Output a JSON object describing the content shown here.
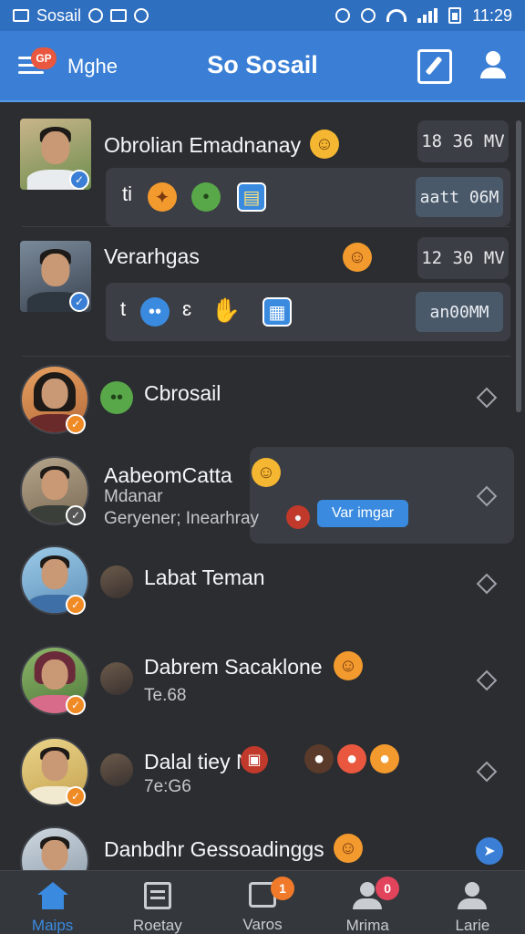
{
  "status_bar": {
    "carrier": "Sosail",
    "time": "11:29"
  },
  "app_bar": {
    "menu_badge": "GP",
    "back_label": "Mghe",
    "title": "So Sosail"
  },
  "cards": [
    {
      "name": "Obrolian Emadnanay",
      "time": "18 36 MV",
      "action": "aatt 06M",
      "lead_glyph": "ti"
    },
    {
      "name": "Verarhgas",
      "time": "12 30 MV",
      "action": "an00MM",
      "lead_glyph": "t",
      "second_glyph": "ɛ"
    }
  ],
  "rows": [
    {
      "name": "Cbrosail"
    },
    {
      "name": "AabeomCatta",
      "line2": "Mdanar",
      "line3": "Geryener; Inearhray",
      "chip": "Var imgar"
    },
    {
      "name": "Labat Teman"
    },
    {
      "name": "Dabrem Sacaklone",
      "sub": "Te.68"
    },
    {
      "name": "Dalal tiey  No",
      "sub": "7e:G6"
    },
    {
      "name": "Danbdhr Gessoadinggs"
    }
  ],
  "bottom_nav": [
    {
      "label": "Maips",
      "active": true
    },
    {
      "label": "Roetay",
      "active": false
    },
    {
      "label": "Varos",
      "badge": "1",
      "active": false
    },
    {
      "label": "Mrima",
      "badge": "0",
      "active": false
    },
    {
      "label": "Larie",
      "active": false
    }
  ],
  "colors": {
    "accent": "#3a7fd5",
    "background": "#2b2d31",
    "card": "#3b3e44",
    "badge_orange": "#f08a24"
  }
}
